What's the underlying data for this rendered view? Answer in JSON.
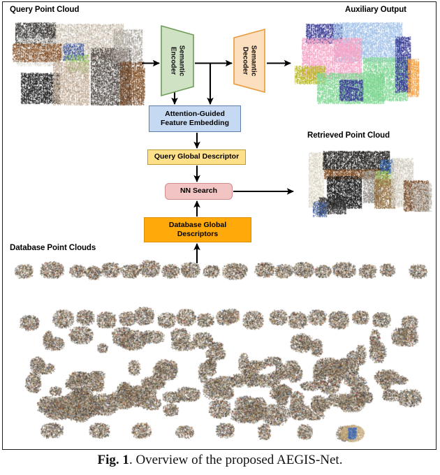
{
  "figure": {
    "caption_label": "Fig. 1",
    "caption_text": ". Overview of the proposed AEGIS-Net."
  },
  "labels": {
    "query_point_cloud": "Query Point Cloud",
    "auxiliary_output": "Auxiliary Output",
    "retrieved_point_cloud": "Retrieved Point Cloud",
    "database_point_clouds": "Database Point Clouds"
  },
  "pipeline": {
    "semantic_encoder": "Semantic\nEncoder",
    "semantic_encoder_line1": "Semantic",
    "semantic_encoder_line2": "Encoder",
    "semantic_decoder_line1": "Semantic",
    "semantic_decoder_line2": "Decoder",
    "attention_line1": "Attention-Guided",
    "attention_line2": "Feature Embedding",
    "query_global_descriptor": "Query Global Descriptor",
    "nn_search": "NN Search",
    "database_global_line1": "Database Global",
    "database_global_line2": "Descriptors"
  },
  "colors": {
    "encoder_fill": "#cfe3c4",
    "encoder_stroke": "#6f9c58",
    "decoder_fill": "#fcdfbe",
    "decoder_stroke": "#e89a38",
    "attention_fill": "#c5daf2",
    "attention_stroke": "#5b7ea8",
    "query_desc_fill": "#ffe08a",
    "query_desc_stroke": "#c19a2e",
    "nn_fill": "#f2c4c4",
    "nn_stroke": "#d08d8d",
    "db_desc_fill": "#ffa90a",
    "db_desc_stroke": "#d98c00",
    "arrow": "#000000",
    "frame": "#1d1d1d"
  },
  "chart_data": {
    "type": "diagram",
    "title": "Overview of the proposed AEGIS-Net",
    "nodes": [
      {
        "id": "query_cloud",
        "label": "Query Point Cloud",
        "kind": "point-cloud-rgb"
      },
      {
        "id": "encoder",
        "label": "Semantic Encoder",
        "kind": "trapezoid",
        "fill": "#cfe3c4"
      },
      {
        "id": "decoder",
        "label": "Semantic Decoder",
        "kind": "trapezoid",
        "fill": "#fcdfbe"
      },
      {
        "id": "aux_output",
        "label": "Auxiliary Output",
        "kind": "point-cloud-semantic"
      },
      {
        "id": "attention",
        "label": "Attention-Guided Feature Embedding",
        "kind": "box",
        "fill": "#c5daf2"
      },
      {
        "id": "query_desc",
        "label": "Query Global Descriptor",
        "kind": "box",
        "fill": "#ffe08a"
      },
      {
        "id": "nn_search",
        "label": "NN Search",
        "kind": "rounded-box",
        "fill": "#f2c4c4"
      },
      {
        "id": "db_desc",
        "label": "Database Global Descriptors",
        "kind": "box",
        "fill": "#ffa90a"
      },
      {
        "id": "retrieved",
        "label": "Retrieved Point Cloud",
        "kind": "point-cloud-rgb"
      },
      {
        "id": "db_clouds",
        "label": "Database Point Clouds",
        "kind": "point-cloud-grid"
      }
    ],
    "edges": [
      {
        "from": "query_cloud",
        "to": "encoder",
        "style": "arrow"
      },
      {
        "from": "encoder",
        "to": "decoder",
        "style": "arrow"
      },
      {
        "from": "decoder",
        "to": "aux_output",
        "style": "arrow"
      },
      {
        "from": "encoder",
        "to": "attention",
        "style": "arrow"
      },
      {
        "from": "encoder_out",
        "to": "attention",
        "style": "arrow"
      },
      {
        "from": "attention",
        "to": "query_desc",
        "style": "arrow"
      },
      {
        "from": "query_desc",
        "to": "nn_search",
        "style": "arrow"
      },
      {
        "from": "db_desc",
        "to": "nn_search",
        "style": "arrow"
      },
      {
        "from": "db_clouds",
        "to": "db_desc",
        "style": "arrow"
      },
      {
        "from": "nn_search",
        "to": "retrieved",
        "style": "arrow"
      }
    ]
  }
}
